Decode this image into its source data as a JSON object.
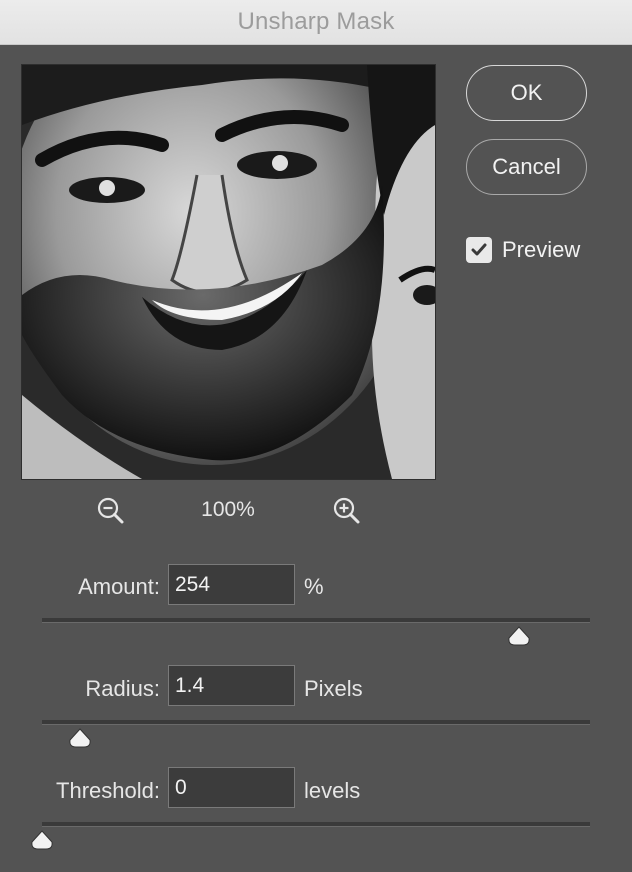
{
  "window": {
    "title": "Unsharp Mask"
  },
  "buttons": {
    "ok_label": "OK",
    "cancel_label": "Cancel"
  },
  "preview": {
    "checkbox_label": "Preview",
    "checked": true
  },
  "zoom": {
    "level": "100%",
    "zoom_out_icon": "zoom-out-magnifier",
    "zoom_in_icon": "zoom-in-magnifier"
  },
  "params": {
    "amount": {
      "label": "Amount:",
      "value": "254",
      "unit": "%",
      "slider_fraction": 0.87
    },
    "radius": {
      "label": "Radius:",
      "value": "1.4",
      "unit": "Pixels",
      "slider_fraction": 0.07
    },
    "threshold": {
      "label": "Threshold:",
      "value": "0",
      "unit": "levels",
      "slider_fraction": 0.0
    }
  },
  "colors": {
    "dialog_bg": "#535353",
    "titlebar_bg": "#e8e8e8",
    "field_bg": "#3c3c3c"
  }
}
